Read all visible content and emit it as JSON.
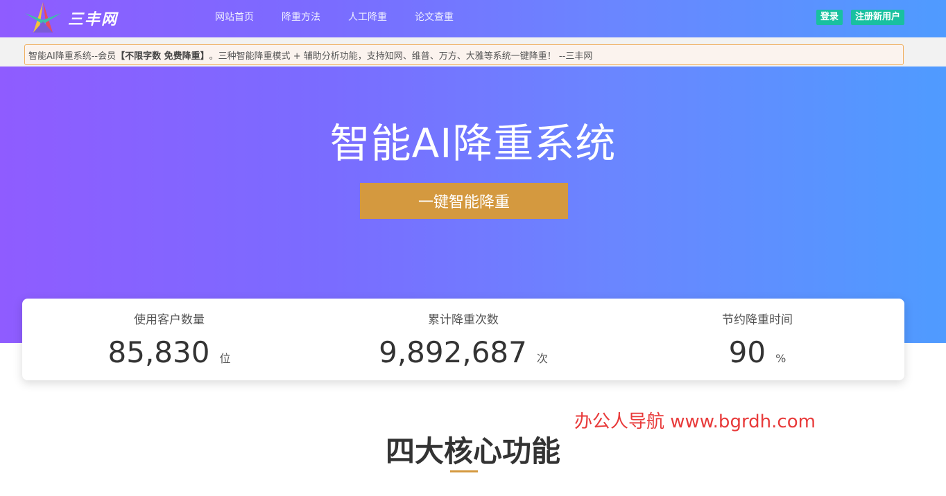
{
  "header": {
    "logo_text": "三丰网",
    "nav": [
      "网站首页",
      "降重方法",
      "人工降重",
      "论文查重"
    ],
    "login_label": "登录",
    "register_label": "注册新用户"
  },
  "notice": {
    "prefix": "智能AI降重系统--会员",
    "highlight": "【不限字数 免费降重】",
    "suffix": "。三种智能降重模式 + 辅助分析功能，支持知网、维普、万方、大雅等系统一键降重！ --三丰网"
  },
  "hero": {
    "title": "智能AI降重系统",
    "cta_label": "一键智能降重"
  },
  "stats": [
    {
      "label": "使用客户数量",
      "value": "85,830",
      "unit": "位"
    },
    {
      "label": "累计降重次数",
      "value": "9,892,687",
      "unit": "次"
    },
    {
      "label": "节约降重时间",
      "value": "90",
      "unit": "%"
    }
  ],
  "watermark": "办公人导航  www.bgrdh.com",
  "section": {
    "title": "四大核心功能"
  },
  "colors": {
    "gradient_start": "#8f5cff",
    "gradient_end": "#4f9bff",
    "cta": "#d4993f",
    "auth_button": "#19c0a0",
    "watermark": "#e83a3a"
  }
}
